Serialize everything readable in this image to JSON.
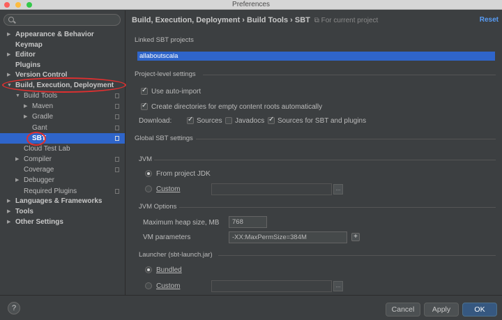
{
  "window": {
    "title": "Preferences"
  },
  "sidebar": {
    "search_placeholder": "",
    "items": [
      {
        "label": "Appearance & Behavior"
      },
      {
        "label": "Keymap"
      },
      {
        "label": "Editor"
      },
      {
        "label": "Plugins"
      },
      {
        "label": "Version Control"
      },
      {
        "label": "Build, Execution, Deployment"
      },
      {
        "label": "Build Tools"
      },
      {
        "label": "Maven"
      },
      {
        "label": "Gradle"
      },
      {
        "label": "Gant"
      },
      {
        "label": "SBT"
      },
      {
        "label": "Cloud Test Lab"
      },
      {
        "label": "Compiler"
      },
      {
        "label": "Coverage"
      },
      {
        "label": "Debugger"
      },
      {
        "label": "Required Plugins"
      },
      {
        "label": "Languages & Frameworks"
      },
      {
        "label": "Tools"
      },
      {
        "label": "Other Settings"
      }
    ],
    "selected": "SBT"
  },
  "main": {
    "breadcrumb": "Build, Execution, Deployment › Build Tools › SBT",
    "for_current_project": "For current project",
    "reset_label": "Reset",
    "linked_projects": {
      "title": "Linked SBT projects",
      "items": [
        "allaboutscala"
      ]
    },
    "project_settings": {
      "title": "Project-level settings",
      "use_auto_import": {
        "label": "Use auto-import",
        "checked": true
      },
      "create_dirs": {
        "label": "Create directories for empty content roots automatically",
        "checked": true
      },
      "download_label": "Download:",
      "sources": {
        "label": "Sources",
        "checked": true
      },
      "javadocs": {
        "label": "Javadocs",
        "checked": false
      },
      "sources_sbt": {
        "label": "Sources for SBT and plugins",
        "checked": true
      }
    },
    "global_settings": {
      "title": "Global SBT settings",
      "jvm": {
        "title": "JVM",
        "from_project_jdk": {
          "label": "From project JDK",
          "selected": true
        },
        "custom": {
          "label": "Custom",
          "selected": false,
          "value": ""
        }
      },
      "jvm_options": {
        "title": "JVM Options",
        "heap_label": "Maximum heap size, MB",
        "heap_value": "768",
        "vm_params_label": "VM parameters",
        "vm_params_value": "-XX:MaxPermSize=384M"
      },
      "launcher": {
        "title": "Launcher (sbt-launch.jar)",
        "bundled": {
          "label": "Bundled",
          "selected": true
        },
        "custom": {
          "label": "Custom",
          "selected": false,
          "value": ""
        }
      }
    }
  },
  "footer": {
    "help_label": "?",
    "cancel_label": "Cancel",
    "apply_label": "Apply",
    "ok_label": "OK"
  },
  "colors": {
    "background": "#3c3f41",
    "selection": "#2f65ca",
    "link": "#589df6",
    "annotation": "#e03030"
  }
}
